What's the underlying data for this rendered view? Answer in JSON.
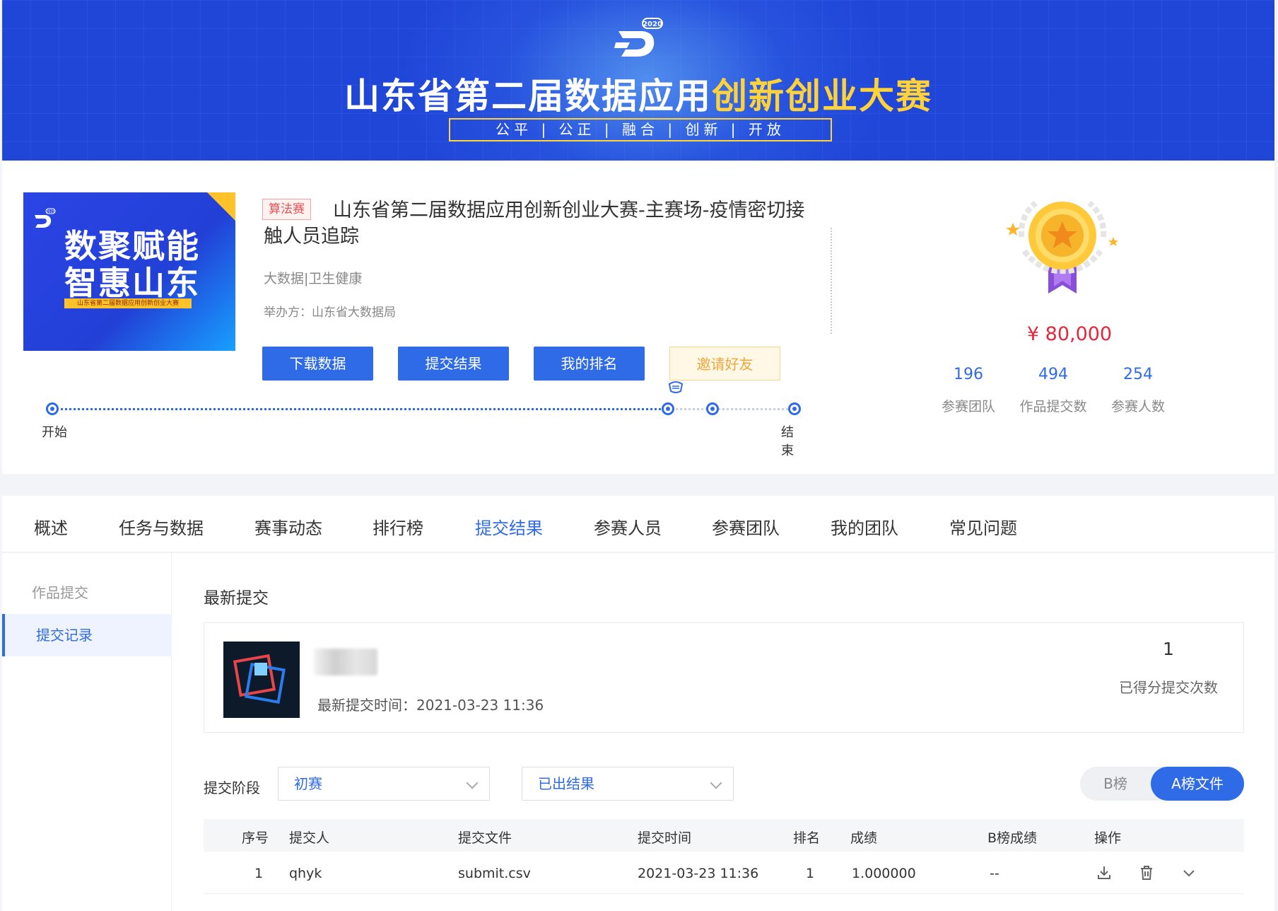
{
  "banner": {
    "year": "2020",
    "title_main": "山东省第二届数据应用",
    "title_highlight": "创新创业大赛",
    "slogan": "公平 | 公正 | 融合 | 创新 | 开放"
  },
  "competition": {
    "tag": "算法赛",
    "title": "山东省第二届数据应用创新创业大赛-主赛场-疫情密切接触人员追踪",
    "category": "大数据|卫生健康",
    "organizer": "举办方：山东省大数据局",
    "cover": {
      "headline_line1": "数聚赋能",
      "headline_line2": "智惠山东",
      "band_text": "山东省第二届数据应用创新创业大赛",
      "year": "2020"
    },
    "buttons": {
      "download": "下载数据",
      "submit": "提交结果",
      "my_rank": "我的排名",
      "invite": "邀请好友"
    },
    "timeline": {
      "start_label": "开始",
      "end_label": "结束",
      "progress": 0.83
    },
    "prize": "¥ 80,000",
    "stats": [
      {
        "value": "196",
        "label": "参赛团队"
      },
      {
        "value": "494",
        "label": "作品提交数"
      },
      {
        "value": "254",
        "label": "参赛人数"
      }
    ]
  },
  "tabs": [
    {
      "label": "概述"
    },
    {
      "label": "任务与数据"
    },
    {
      "label": "赛事动态"
    },
    {
      "label": "排行榜"
    },
    {
      "label": "提交结果"
    },
    {
      "label": "参赛人员"
    },
    {
      "label": "参赛团队"
    },
    {
      "label": "我的团队"
    },
    {
      "label": "常见问题"
    }
  ],
  "active_tab": "提交结果",
  "sidenav": [
    {
      "label": "作品提交"
    },
    {
      "label": "提交记录"
    }
  ],
  "latest": {
    "section_title": "最新提交",
    "last_submit_time": "最新提交时间：2021-03-23 11:36",
    "scored_count": "1",
    "scored_count_label": "已得分提交次数"
  },
  "filters": {
    "stage_label": "提交阶段",
    "stage_value": "初赛",
    "status_value": "已出结果",
    "toggle_b": "B榜",
    "toggle_a": "A榜文件"
  },
  "table": {
    "headers": [
      "序号",
      "提交人",
      "提交文件",
      "提交时间",
      "排名",
      "成绩",
      "B榜成绩",
      "操作"
    ],
    "rows": [
      {
        "index": "1",
        "submitter": "qhyk",
        "file": "submit.csv",
        "time": "2021-03-23 11:36",
        "rank": "1",
        "score": "1.000000",
        "b_score": "--"
      }
    ]
  },
  "colors": {
    "primary": "#2f6be6",
    "banner": "#2046d8",
    "highlight": "#ffd23a",
    "prize": "#e8253a"
  }
}
